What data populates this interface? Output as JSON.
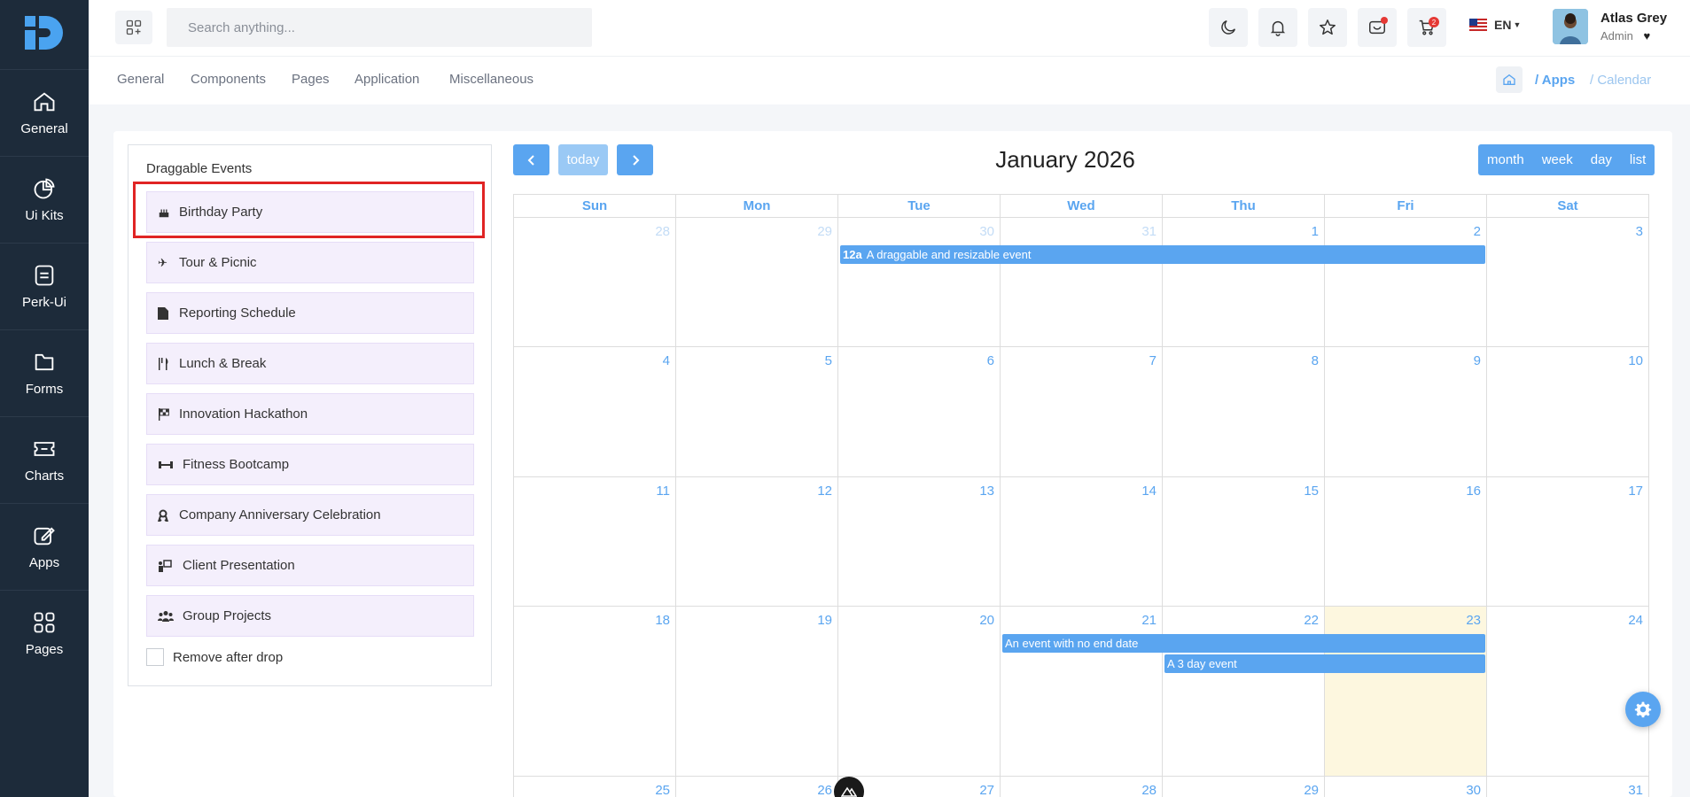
{
  "sidebar": {
    "items": [
      {
        "label": "General",
        "icon": "home-icon"
      },
      {
        "label": "Ui Kits",
        "icon": "pie-chart-icon"
      },
      {
        "label": "Perk-Ui",
        "icon": "document-icon"
      },
      {
        "label": "Forms",
        "icon": "folder-icon"
      },
      {
        "label": "Charts",
        "icon": "ticket-icon"
      },
      {
        "label": "Apps",
        "icon": "edit-icon"
      },
      {
        "label": "Pages",
        "icon": "grid-icon"
      }
    ]
  },
  "topbar": {
    "search_placeholder": "Search anything...",
    "cart_count": "2",
    "language": "EN",
    "user_name": "Atlas Grey",
    "user_role": "Admin"
  },
  "subnav": {
    "links": [
      "General",
      "Components",
      "Pages",
      "Application",
      "Miscellaneous"
    ],
    "breadcrumb": [
      "/ Apps",
      "/ Calendar"
    ]
  },
  "events_panel": {
    "title": "Draggable Events",
    "events": [
      {
        "label": "Birthday Party",
        "icon": "cake-icon"
      },
      {
        "label": "Tour & Picnic",
        "icon": "plane-icon"
      },
      {
        "label": "Reporting Schedule",
        "icon": "file-icon"
      },
      {
        "label": "Lunch & Break",
        "icon": "utensils-icon"
      },
      {
        "label": "Innovation Hackathon",
        "icon": "flag-icon"
      },
      {
        "label": "Fitness Bootcamp",
        "icon": "dumbbell-icon"
      },
      {
        "label": "Company Anniversary Celebration",
        "icon": "ribbon-icon"
      },
      {
        "label": "Client Presentation",
        "icon": "presentation-icon"
      },
      {
        "label": "Group Projects",
        "icon": "users-icon"
      }
    ],
    "remove_after_drop": "Remove after drop"
  },
  "calendar": {
    "title": "January 2026",
    "today_label": "today",
    "views": [
      "month",
      "week",
      "day",
      "list"
    ],
    "weekdays": [
      "Sun",
      "Mon",
      "Tue",
      "Wed",
      "Thu",
      "Fri",
      "Sat"
    ],
    "weeks": [
      [
        "28",
        "29",
        "30",
        "31",
        "1",
        "2",
        "3"
      ],
      [
        "4",
        "5",
        "6",
        "7",
        "8",
        "9",
        "10"
      ],
      [
        "11",
        "12",
        "13",
        "14",
        "15",
        "16",
        "17"
      ],
      [
        "18",
        "19",
        "20",
        "21",
        "22",
        "23",
        "24"
      ],
      [
        "25",
        "26",
        "27",
        "28",
        "29",
        "30",
        "31"
      ]
    ],
    "today_date": "23",
    "events": [
      {
        "time": "12a",
        "title": "A draggable and resizable event"
      },
      {
        "title": "An event with no end date"
      },
      {
        "title": "A 3 day event"
      }
    ]
  },
  "colors": {
    "sidebar_bg": "#1d2b3a",
    "accent": "#5aa5f0",
    "event_chip_bg": "#f4effc",
    "today_bg": "#fdf7df",
    "highlight": "#e02424"
  }
}
